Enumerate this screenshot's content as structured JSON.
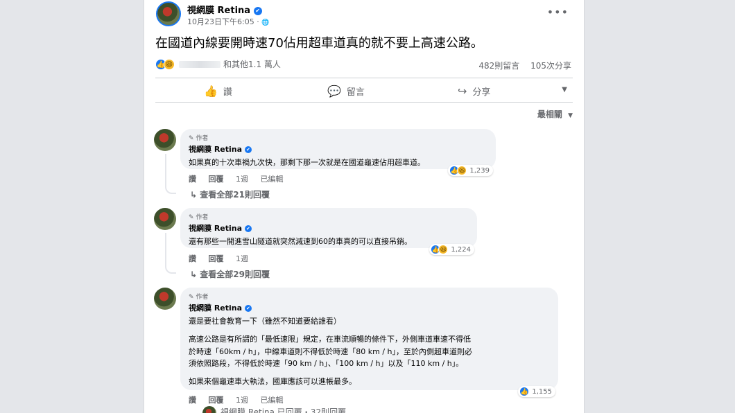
{
  "post": {
    "page_name": "視網膜 Retina",
    "verified_glyph": "✔",
    "timestamp": "10月23日下午6:05",
    "privacy_glyph": "🌐",
    "more_glyph": "•••",
    "text": "在國道內線要開時速70佔用超車道真的就不要上高速公路。",
    "reaction_names_suffix": "和其他1.1 萬人",
    "comment_count": "482則留言",
    "share_count": "105次分享"
  },
  "actions": [
    {
      "label": "讚",
      "icon": "like-icon",
      "glyph": "👍"
    },
    {
      "label": "留言",
      "icon": "comment-icon",
      "glyph": "💬"
    },
    {
      "label": "分享",
      "icon": "share-icon",
      "glyph": "↪"
    }
  ],
  "sort_label": "最相關",
  "comments": [
    {
      "badge": "作者",
      "name": "視網膜 Retina",
      "text": "如果真的十次車禍九次快，那剩下那一次就是在國道龜速佔用超車道。",
      "reaction_count": "1,239",
      "reactions": [
        "like",
        "haha"
      ],
      "actions": [
        "讚",
        "回覆",
        "1週",
        "已編輯"
      ],
      "view_replies": "查看全部21則回覆"
    },
    {
      "badge": "作者",
      "name": "視網膜 Retina",
      "text": "還有那些一開進雪山隧道就突然減速到60的車真的可以直接吊銷。",
      "reaction_count": "1,224",
      "reactions": [
        "like",
        "haha"
      ],
      "actions": [
        "讚",
        "回覆",
        "1週"
      ],
      "view_replies": "查看全部29則回覆"
    },
    {
      "badge": "作者",
      "name": "視網膜 Retina",
      "text": "還是要社會教育一下（雖然不知道要給誰看）",
      "paragraph_lines": [
        "高速公路是有所謂的「最低速限」規定，在車流順暢的條件下，外側車道車速不得低",
        "於時速「60km / h」，中線車道則不得低於時速「80 km / h」，至於內側超車道則必",
        "須依照路段，不得低於時速「90 km / h」、「100 km / h」以及「110 km / h」。"
      ],
      "closing": "如果來個龜速車大執法，國庫應該可以進帳最多。",
      "reaction_count": "1,155",
      "reactions": [
        "like"
      ],
      "actions": [
        "讚",
        "回覆",
        "1週",
        "已編輯"
      ],
      "partial_reply": "視網膜 Retina 已回覆・32則回覆"
    }
  ]
}
